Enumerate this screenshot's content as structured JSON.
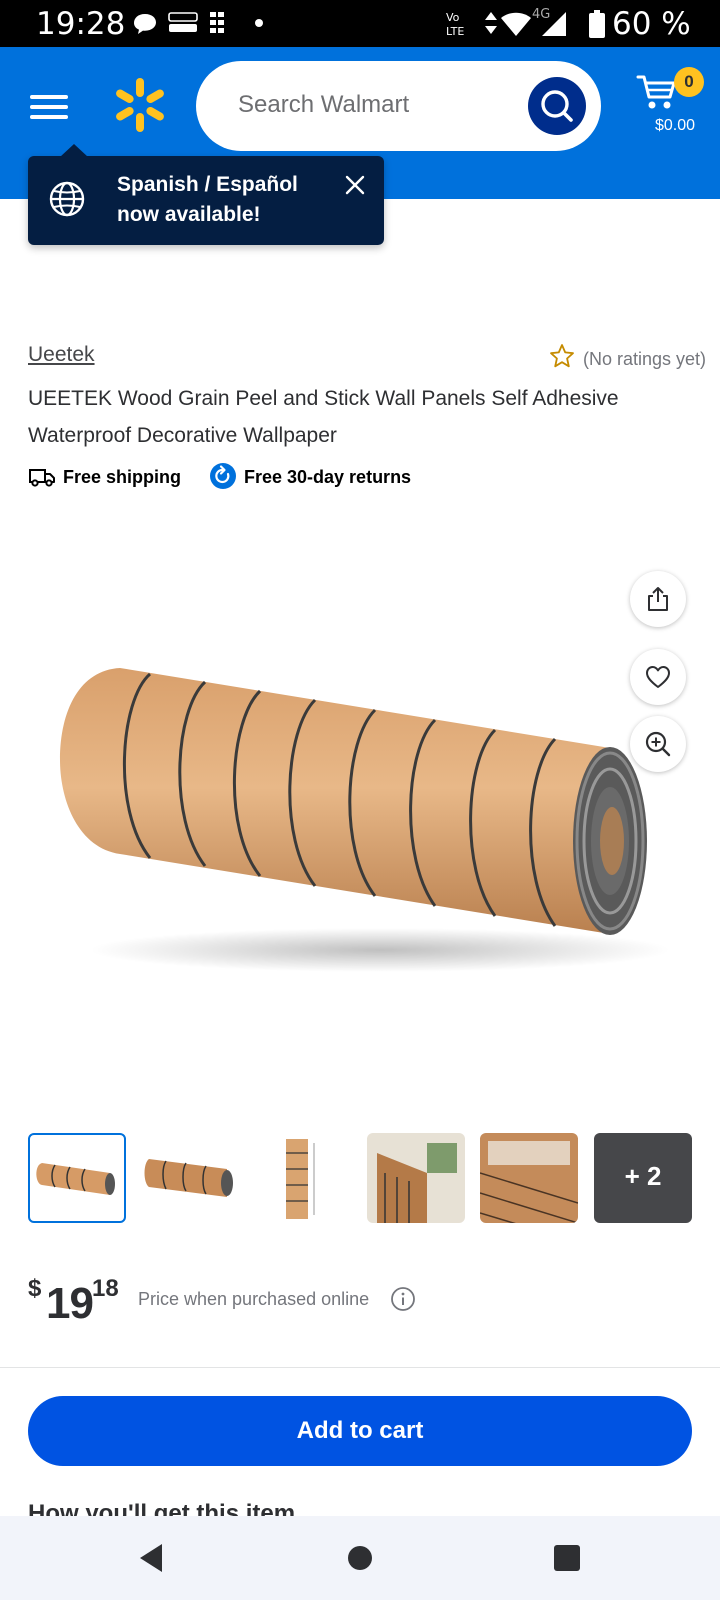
{
  "status_bar": {
    "time": "19:28",
    "battery": "60 %",
    "network": "4G",
    "volte": "Vo LTE",
    "notification_icons": [
      "chat-icon",
      "temu-icon",
      "game-icon",
      "dot-icon"
    ]
  },
  "header": {
    "search_placeholder": "Search Walmart",
    "cart_count": "0",
    "cart_amount": "$0.00",
    "colors": {
      "background": "#0071dc",
      "spark": "#ffc220",
      "search_button": "#002d8c"
    }
  },
  "language_tooltip": {
    "text": "Spanish / Español now available!",
    "background": "#041e42"
  },
  "product": {
    "brand": "Ueetek",
    "rating_text": "(No ratings yet)",
    "title": "UEETEK Wood Grain Peel and Stick Wall Panels Self Adhesive Waterproof Decorative Wallpaper",
    "perks": [
      {
        "label": "Free shipping",
        "icon": "truck-icon"
      },
      {
        "label": "Free 30-day returns",
        "icon": "return-icon"
      }
    ],
    "more_images_label": "+ 2",
    "price": {
      "currency": "$",
      "whole": "19",
      "cents": "18",
      "note": "Price when purchased online"
    },
    "add_to_cart": "Add to cart",
    "next_section_peek": "How you'll get this item"
  },
  "nav_bar": {
    "buttons": [
      "back-icon",
      "home-icon",
      "recents-icon"
    ]
  }
}
